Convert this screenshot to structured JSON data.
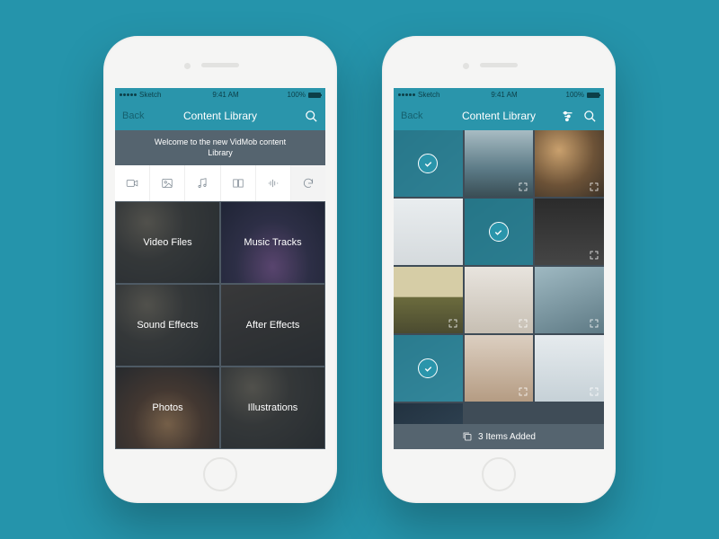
{
  "status": {
    "carrier": "Sketch",
    "time": "9:41 AM",
    "battery": "100%"
  },
  "left": {
    "nav": {
      "back": "Back",
      "title": "Content Library"
    },
    "welcome": "Welcome to the new VidMob content Library",
    "tools": [
      "video",
      "image",
      "music",
      "book",
      "wave",
      "undo"
    ],
    "categories": [
      "Video Files",
      "Music Tracks",
      "Sound Effects",
      "After Effects",
      "Photos",
      "Illustrations"
    ]
  },
  "right": {
    "nav": {
      "back": "Back",
      "title": "Content Library"
    },
    "selected": [
      0,
      4,
      9
    ],
    "footer": "3 Items Added"
  }
}
